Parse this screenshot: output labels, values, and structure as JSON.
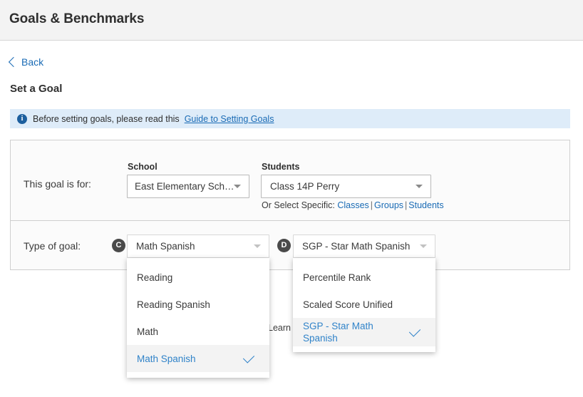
{
  "header": {
    "title": "Goals & Benchmarks"
  },
  "nav": {
    "back_label": "Back",
    "back_icon": "chevron-left-icon"
  },
  "page": {
    "section_title": "Set a Goal"
  },
  "info_banner": {
    "icon": "info-icon",
    "icon_glyph": "i",
    "text": "Before setting goals, please read this",
    "link_label": "Guide to Setting Goals",
    "background_color": "#deecf9",
    "link_color": "#1a6bb5"
  },
  "goal_for_row": {
    "label": "This goal is for:",
    "school": {
      "label": "School",
      "value": "East Elementary Sch…",
      "caret_icon": "chevron-down-icon"
    },
    "students": {
      "label": "Students",
      "value": "Class 14P Perry",
      "caret_icon": "chevron-down-icon"
    },
    "or_select": {
      "prefix": "Or Select Specific:",
      "links": [
        "Classes",
        "Groups",
        "Students"
      ],
      "separator": "|"
    }
  },
  "goal_type_row": {
    "label": "Type of goal:",
    "badge_c": "C",
    "badge_d": "D",
    "goal_type_select": {
      "value": "Math Spanish",
      "caret_icon": "chevron-down-icon",
      "options": [
        {
          "label": "Reading",
          "selected": false
        },
        {
          "label": "Reading Spanish",
          "selected": false
        },
        {
          "label": "Math",
          "selected": false
        },
        {
          "label": "Math Spanish",
          "selected": true
        }
      ]
    },
    "measure_select": {
      "value": "SGP - Star Math Spanish",
      "caret_icon": "chevron-down-icon",
      "options": [
        {
          "label": "Percentile Rank",
          "selected": false
        },
        {
          "label": "Scaled Score Unified",
          "selected": false
        },
        {
          "label": "SGP - Star Math Spanish",
          "selected": true
        }
      ]
    },
    "occluded_text": "Learn"
  },
  "colors": {
    "link": "#1a6bb5",
    "selected_option": "#3083c9",
    "header_bg": "#f3f3f3",
    "badge_bg": "#4a4a4a"
  }
}
